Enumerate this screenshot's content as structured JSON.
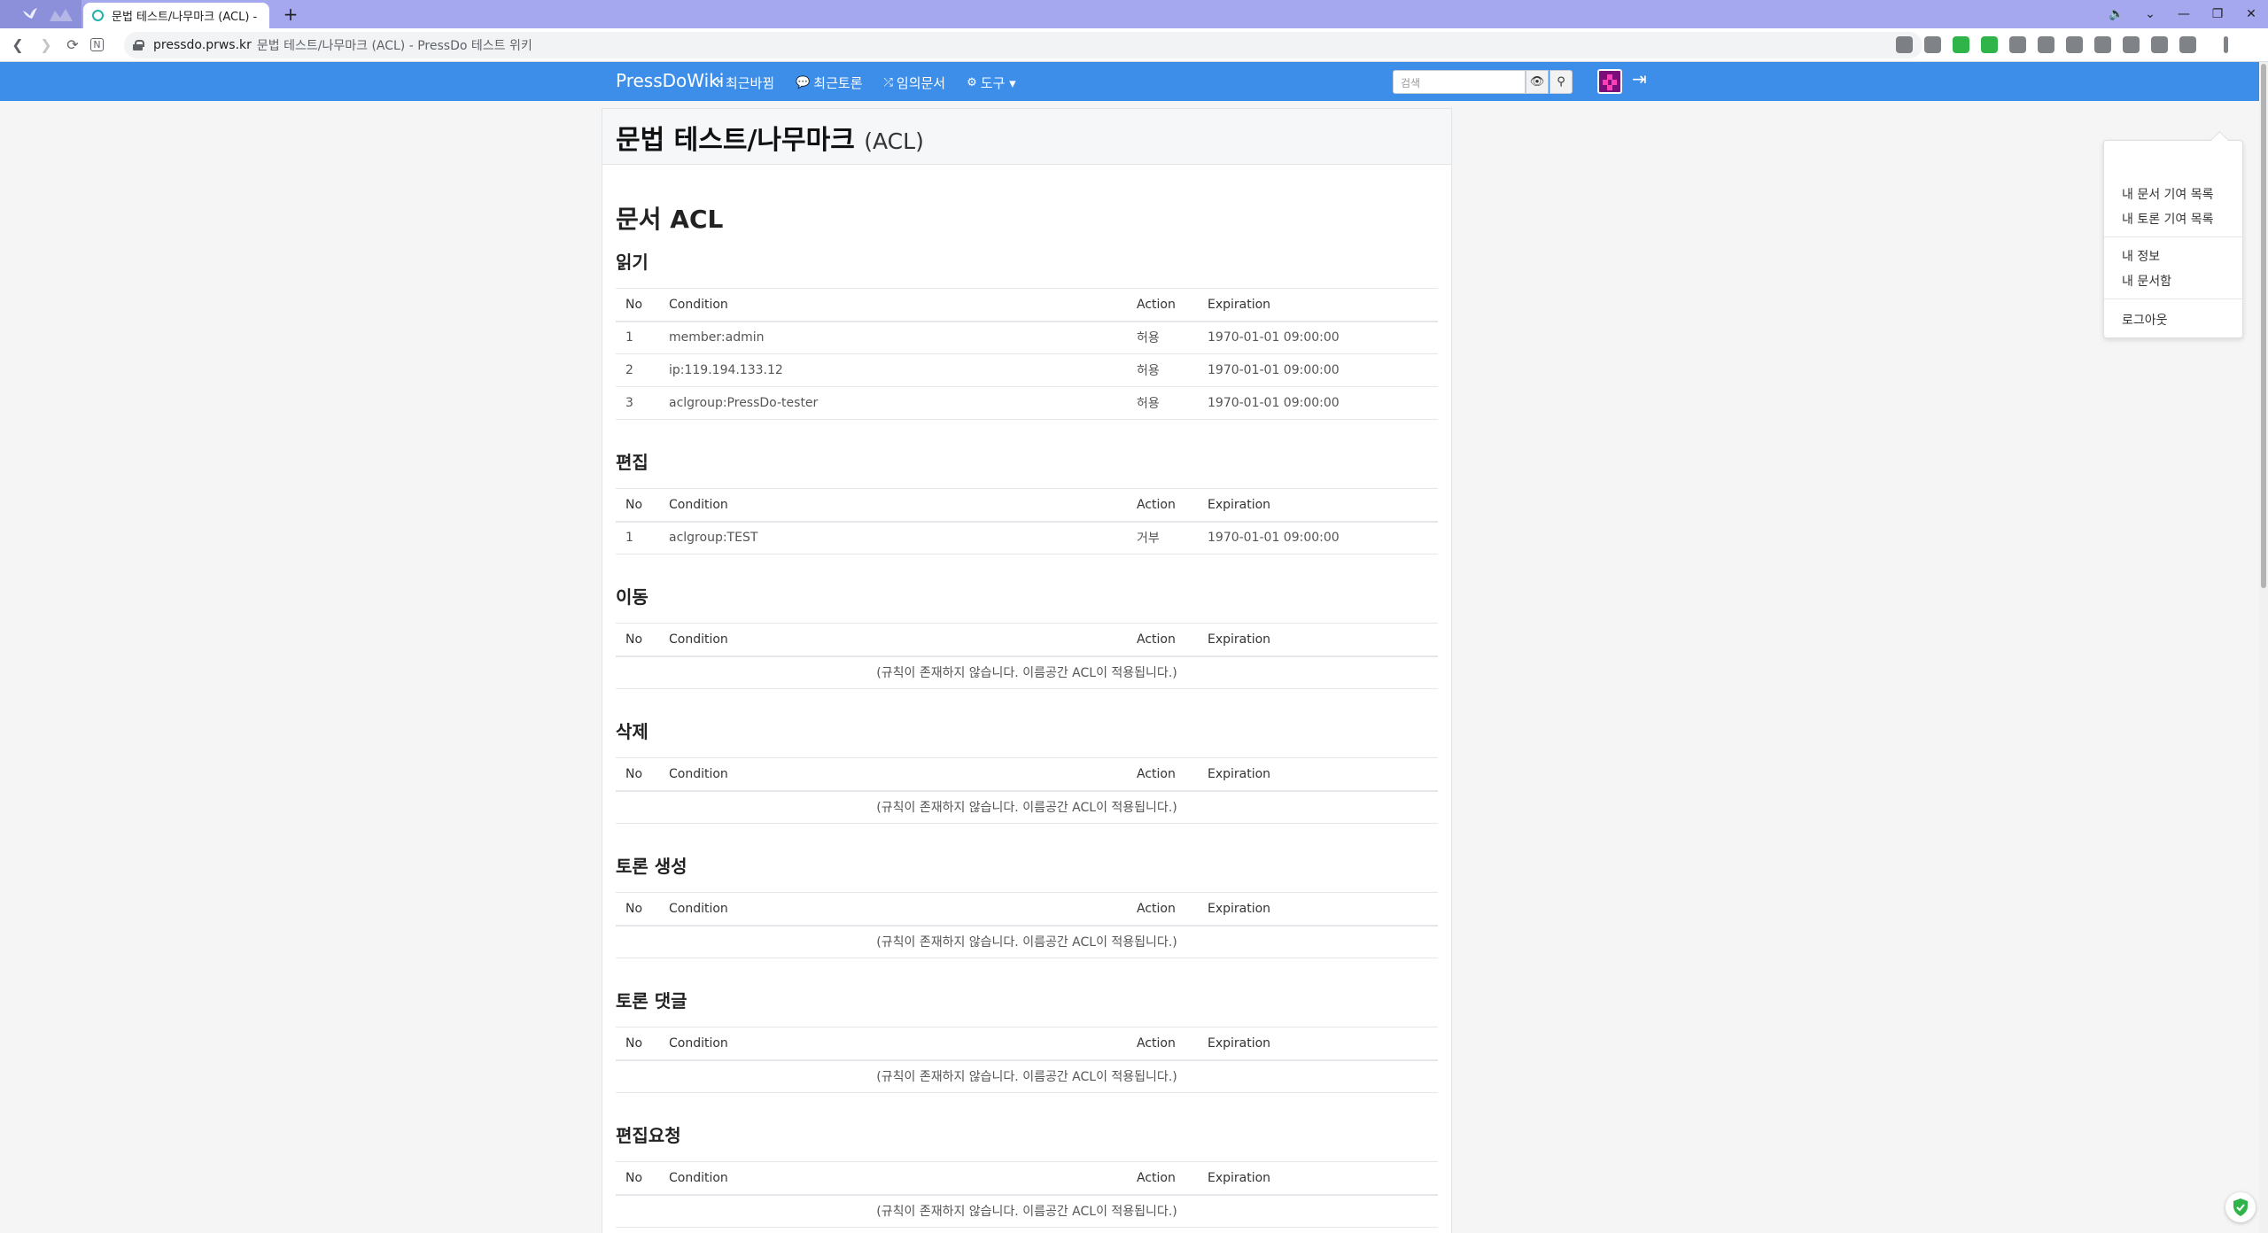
{
  "browser": {
    "tab_title": "문법 테스트/나무마크 (ACL) - P",
    "new_tab_label": "+",
    "url_host": "pressdo.prws.kr",
    "url_rest": "문법 테스트/나무마크 (ACL) - PressDo 테스트 위키",
    "window_controls": [
      "🔈",
      "⌄",
      "—",
      "❐",
      "✕"
    ]
  },
  "navbar": {
    "brand": "PressDoWiki",
    "links": [
      {
        "icon": "refresh-icon",
        "glyph": "⟳",
        "label": "최근바뀜"
      },
      {
        "icon": "comments-icon",
        "glyph": "💬",
        "label": "최근토론"
      },
      {
        "icon": "random-icon",
        "glyph": "⤮",
        "label": "임의문서"
      },
      {
        "icon": "gear-icon",
        "glyph": "⚙",
        "label": "도구 ▾"
      }
    ],
    "search_placeholder": "검색"
  },
  "page": {
    "title": "문법 테스트/나무마크",
    "title_suffix": "(ACL)",
    "heading": "문서 ACL",
    "columns": {
      "no": "No",
      "condition": "Condition",
      "action": "Action",
      "expiration": "Expiration"
    },
    "sections": [
      {
        "title": "읽기",
        "rows": [
          {
            "no": "1",
            "condition": "member:admin",
            "action": "허용",
            "expiration": "1970-01-01 09:00:00"
          },
          {
            "no": "2",
            "condition": "ip:119.194.133.12",
            "action": "허용",
            "expiration": "1970-01-01 09:00:00"
          },
          {
            "no": "3",
            "condition": "aclgroup:PressDo-tester",
            "action": "허용",
            "expiration": "1970-01-01 09:00:00"
          }
        ]
      },
      {
        "title": "편집",
        "rows": [
          {
            "no": "1",
            "condition": "aclgroup:TEST",
            "action": "거부",
            "expiration": "1970-01-01 09:00:00"
          }
        ]
      },
      {
        "title": "이동",
        "empty": "(규칙이 존재하지 않습니다. 이름공간 ACL이 적용됩니다.)"
      },
      {
        "title": "삭제",
        "empty": "(규칙이 존재하지 않습니다. 이름공간 ACL이 적용됩니다.)"
      },
      {
        "title": "토론 생성",
        "empty": "(규칙이 존재하지 않습니다. 이름공간 ACL이 적용됩니다.)"
      },
      {
        "title": "토론 댓글",
        "empty": "(규칙이 존재하지 않습니다. 이름공간 ACL이 적용됩니다.)"
      },
      {
        "title": "편집요청",
        "empty": "(규칙이 존재하지 않습니다. 이름공간 ACL이 적용됩니다.)"
      }
    ]
  },
  "user_menu": {
    "contrib_docs": "내 문서 기여 목록",
    "contrib_discuss": "내 토론 기여 목록",
    "my_info": "내 정보",
    "my_starred": "내 문서함",
    "logout": "로그아웃"
  },
  "colors": {
    "navbar": "#3c8ee9",
    "tabstrip": "#a6a8ef",
    "avatar": "#7b0f79"
  }
}
